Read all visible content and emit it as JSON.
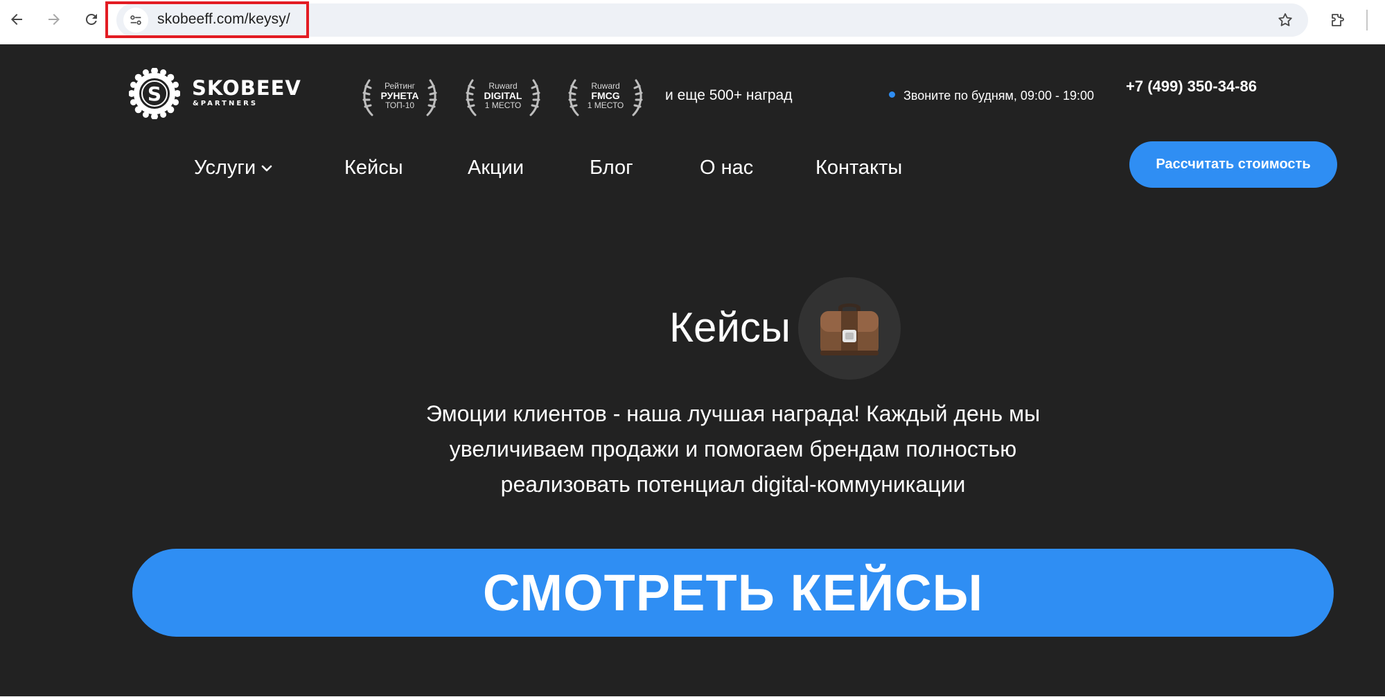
{
  "browser": {
    "url": "skobeeff.com/keysy/",
    "icons": [
      "back-icon",
      "forward-icon",
      "reload-icon",
      "site-info-icon",
      "bookmark-star-icon",
      "extensions-icon"
    ]
  },
  "header": {
    "logo": {
      "name": "SKOBEEV",
      "sub": "&PARTNERS",
      "badge_letter": "S"
    },
    "awards": [
      {
        "line1": "Рейтинг",
        "line2": "РУНЕТА",
        "line3": "ТОП-10"
      },
      {
        "line1": "Ruward",
        "line2": "DIGITAL",
        "line3": "1 МЕСТО"
      },
      {
        "line1": "Ruward",
        "line2": "FMCG",
        "line3": "1 МЕСТО"
      }
    ],
    "awards_more": "и еще 500+ наград",
    "call_hours": "Звоните по будням, 09:00 - 19:00",
    "phone": "+7 (499) 350-34-86",
    "cta": "Рассчитать стоимость"
  },
  "nav": {
    "items": [
      {
        "label": "Услуги"
      },
      {
        "label": "Кейсы"
      },
      {
        "label": "Акции"
      },
      {
        "label": "Блог"
      },
      {
        "label": "О нас"
      },
      {
        "label": "Контакты"
      }
    ]
  },
  "hero": {
    "title": "Кейсы",
    "icon": "briefcase-icon",
    "text_lines": [
      "Эмоции клиентов - наша лучшая награда! Каждый день мы",
      "увеличиваем продажи и помогаем брендам полностью",
      "реализовать потенциал digital-коммуникации"
    ],
    "cta": "СМОТРЕТЬ КЕЙСЫ"
  },
  "colors": {
    "page_bg": "#222222",
    "accent": "#2f8ef3",
    "highlight": "#e31c23"
  }
}
